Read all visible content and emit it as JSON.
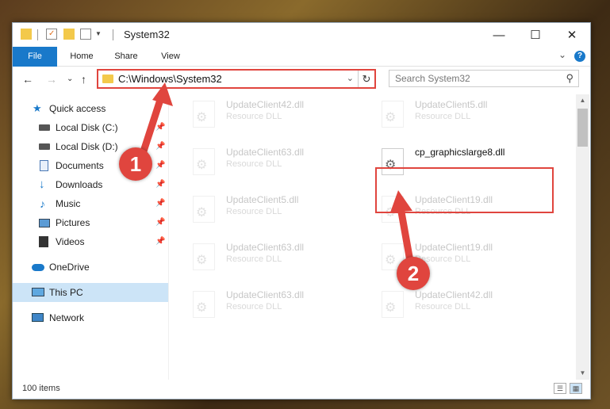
{
  "window": {
    "title": "System32",
    "minimize_glyph": "—",
    "maximize_glyph": "☐",
    "close_glyph": "✕"
  },
  "ribbon": {
    "tabs": [
      "File",
      "Home",
      "Share",
      "View"
    ],
    "collapse_glyph": "⌄",
    "help_glyph": "?"
  },
  "address": {
    "path": "C:\\Windows\\System32",
    "dropdown_glyph": "⌄",
    "refresh_glyph": "↻",
    "back_glyph": "←",
    "forward_glyph": "→",
    "recent_glyph": "⌄",
    "up_glyph": "↑"
  },
  "search": {
    "placeholder": "Search System32",
    "icon_glyph": "⚲"
  },
  "sidebar": {
    "pin_glyph": "📌",
    "items": [
      {
        "label": "Quick access",
        "icon": "star-icon"
      },
      {
        "label": "Local Disk (C:)",
        "icon": "drive-icon",
        "pinned": true
      },
      {
        "label": "Local Disk (D:)",
        "icon": "drive-icon",
        "pinned": true
      },
      {
        "label": "Documents",
        "icon": "documents-icon",
        "pinned": true
      },
      {
        "label": "Downloads",
        "icon": "downloads-icon",
        "pinned": true
      },
      {
        "label": "Music",
        "icon": "music-icon",
        "pinned": true
      },
      {
        "label": "Pictures",
        "icon": "pictures-icon",
        "pinned": true
      },
      {
        "label": "Videos",
        "icon": "videos-icon",
        "pinned": true
      },
      {
        "label": "OneDrive",
        "icon": "onedrive-icon"
      },
      {
        "label": "This PC",
        "icon": "computer-icon",
        "selected": true
      },
      {
        "label": "Network",
        "icon": "network-icon"
      }
    ]
  },
  "files": [
    {
      "name": "UpdateClient42.dll",
      "type": "Resource DLL"
    },
    {
      "name": "UpdateClient5.dll",
      "type": "Resource DLL"
    },
    {
      "name": "UpdateClient63.dll",
      "type": "Resource DLL"
    },
    {
      "name": "cp_graphicslarge8.dll",
      "type": ""
    },
    {
      "name": "UpdateClient5.dll",
      "type": "Resource DLL"
    },
    {
      "name": "UpdateClient19.dll",
      "type": "Resource DLL"
    },
    {
      "name": "UpdateClient63.dll",
      "type": "Resource DLL"
    },
    {
      "name": "UpdateClient19.dll",
      "type": "Resource DLL"
    },
    {
      "name": "UpdateClient63.dll",
      "type": "Resource DLL"
    },
    {
      "name": "UpdateClient42.dll",
      "type": "Resource DLL"
    }
  ],
  "status": {
    "item_count": "100 items"
  },
  "callouts": [
    "1",
    "2"
  ],
  "colors": {
    "accent": "#1979ca",
    "highlight": "#e0453e",
    "selection": "#cce4f7"
  }
}
